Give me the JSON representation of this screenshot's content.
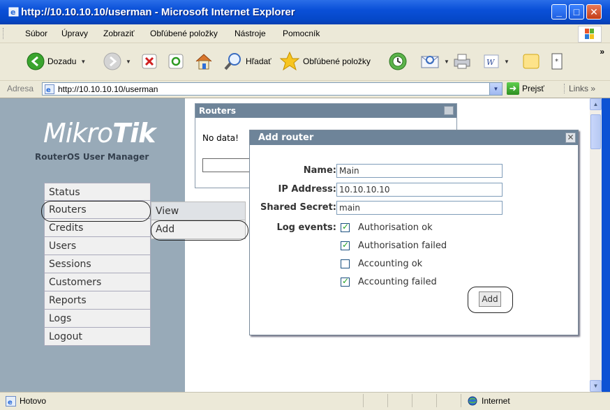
{
  "window": {
    "title": "http://10.10.10.10/userman - Microsoft Internet Explorer"
  },
  "menubar": {
    "items": [
      "Súbor",
      "Úpravy",
      "Zobraziť",
      "Obľúbené položky",
      "Nástroje",
      "Pomocník"
    ]
  },
  "toolbar": {
    "back_label": "Dozadu",
    "search_label": "Hľadať",
    "favorites_label": "Obľúbené položky"
  },
  "addressbar": {
    "label": "Adresa",
    "url": "http://10.10.10.10/userman",
    "go_label": "Prejsť",
    "links_label": "Links"
  },
  "brand": {
    "logo_light": "Mikro",
    "logo_bold": "Tik",
    "subtitle": "RouterOS User Manager"
  },
  "sidebar": {
    "items": [
      "Status",
      "Routers",
      "Credits",
      "Users",
      "Sessions",
      "Customers",
      "Reports",
      "Logs",
      "Logout"
    ],
    "submenu": [
      "View",
      "Add"
    ]
  },
  "routers_panel": {
    "title": "Routers",
    "empty_text": "No data!"
  },
  "dialog": {
    "title": "Add router",
    "name_label": "Name:",
    "name_value": "Main",
    "ip_label": "IP Address:",
    "ip_value": "10.10.10.10",
    "secret_label": "Shared Secret:",
    "secret_value": "main",
    "log_label": "Log events:",
    "log_events": [
      {
        "label": "Authorisation ok",
        "checked": true
      },
      {
        "label": "Authorisation failed",
        "checked": true
      },
      {
        "label": "Accounting ok",
        "checked": false
      },
      {
        "label": "Accounting failed",
        "checked": true
      }
    ],
    "add_button": "Add"
  },
  "status": {
    "text": "Hotovo",
    "zone": "Internet"
  }
}
